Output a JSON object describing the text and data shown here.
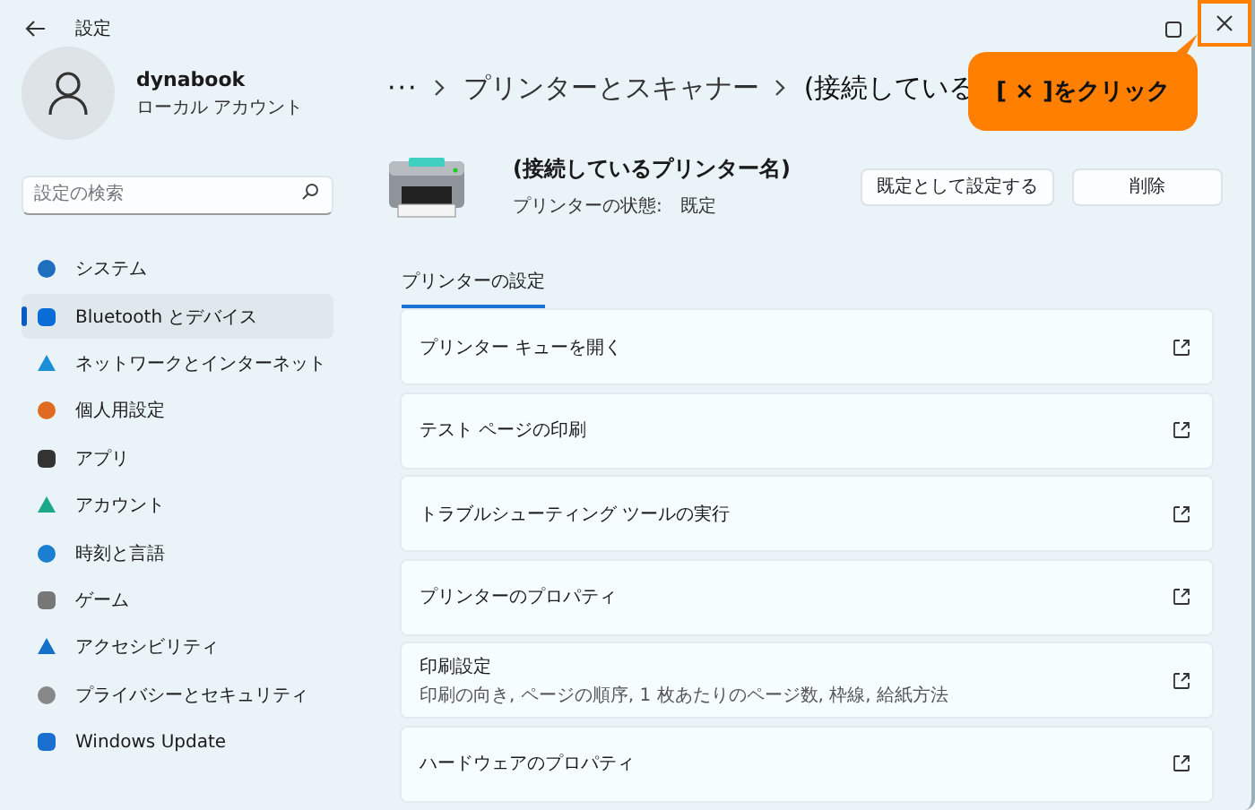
{
  "window": {
    "title": "設定"
  },
  "profile": {
    "name": "dynabook",
    "account": "ローカル アカウント"
  },
  "search": {
    "placeholder": "設定の検索"
  },
  "sidebar": {
    "items": [
      {
        "label": "システム",
        "selected": false
      },
      {
        "label": "Bluetooth とデバイス",
        "selected": true
      },
      {
        "label": "ネットワークとインターネット",
        "selected": false
      },
      {
        "label": "個人用設定",
        "selected": false
      },
      {
        "label": "アプリ",
        "selected": false
      },
      {
        "label": "アカウント",
        "selected": false
      },
      {
        "label": "時刻と言語",
        "selected": false
      },
      {
        "label": "ゲーム",
        "selected": false
      },
      {
        "label": "アクセシビリティ",
        "selected": false
      },
      {
        "label": "プライバシーとセキュリティ",
        "selected": false
      },
      {
        "label": "Windows Update",
        "selected": false
      }
    ]
  },
  "breadcrumb": {
    "more": "···",
    "items": [
      "プリンターとスキャナー",
      "(接続している"
    ]
  },
  "printer": {
    "name": "(接続しているプリンター名)",
    "status": "プリンターの状態:　既定",
    "buttons": [
      "既定として設定する",
      "削除"
    ]
  },
  "tabs": [
    {
      "label": "プリンターの設定",
      "selected": true
    }
  ],
  "settings": [
    {
      "title": "プリンター キューを開く"
    },
    {
      "title": "テスト ページの印刷"
    },
    {
      "title": "トラブルシューティング ツールの実行"
    },
    {
      "title": "プリンターのプロパティ"
    },
    {
      "title": "印刷設定",
      "subtitle": "印刷の向き, ページの順序, 1 枚あたりのページ数, 枠線, 給紙方法"
    },
    {
      "title": "ハードウェアのプロパティ"
    }
  ],
  "callout": {
    "text": "[ × ]をクリック"
  }
}
